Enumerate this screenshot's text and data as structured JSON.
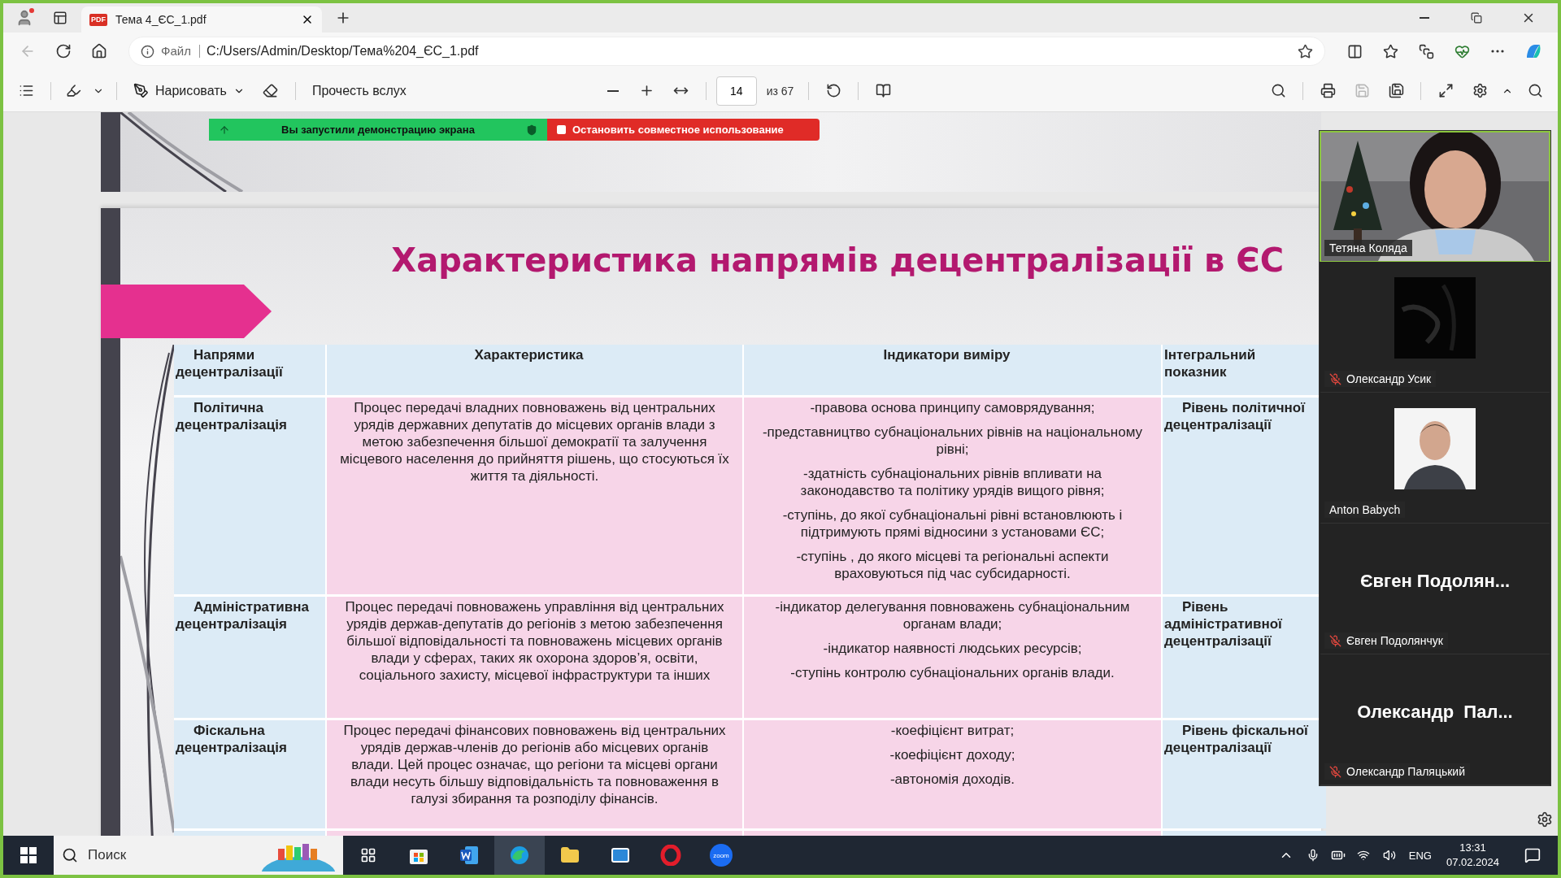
{
  "browser": {
    "tab": {
      "title": "Тема 4_ЄС_1.pdf",
      "file_badge": "PDF",
      "selected": true
    },
    "back": {
      "disabled": true
    },
    "address": {
      "scheme": "Файл",
      "url": "C:/Users/Admin/Desktop/Тема%204_ЄС_1.pdf"
    }
  },
  "pdf_toolbar": {
    "draw_label": "Нарисовать",
    "read_aloud_label": "Прочесть вслух",
    "page": "14",
    "page_total": "из 67",
    "save": {
      "disabled": true
    }
  },
  "share_banner": {
    "status": "Вы запустили демонстрацию экрана",
    "stop_label": "Остановить совместное использование"
  },
  "slide": {
    "title": "Характеристика напрямів децентралізації в ЄС",
    "table": {
      "columns": [
        "Напрями децентралізації",
        "Характеристика",
        "Індикатори виміру",
        "Інтегральний показник"
      ],
      "rows": [
        {
          "direction": "Політична децентралізація",
          "description": "Процес передачі владних повноважень від центральних урядів державних депутатів до місцевих органів влади з метою забезпечення більшої демократії та залучення місцевого населення до прийняття рішень, що стосуються їх життя та діяльності.",
          "indicators": [
            "-правова основа принципу самоврядування;",
            "-представництво субнаціональних рівнів на національному рівні;",
            "-здатність субнаціональних рівнів впливати на законодавство та політику урядів вищого рівня;",
            "-ступінь, до якої субнаціональні рівні встановлюють і підтримують прямі відносини з установами ЄС;",
            "-ступінь , до якого місцеві та регіональні аспекти враховуються під час субсидарності."
          ],
          "integral": "Рівень політичної децентралізації"
        },
        {
          "direction": "Адміністративна децентралізація",
          "description": "Процес передачі повноважень управління від центральних урядів держав-депутатів до регіонів з метою забезпечення більшої відповідальності та повноважень місцевих органів влади у сферах, таких як охорона здоров’я, освіти, соціального захисту, місцевої інфраструктури та інших",
          "indicators": [
            "-індикатор делегування повноважень субнаціональним органам влади;",
            "-індикатор наявності людських ресурсів;",
            "-ступінь контролю субнаціональних органів влади."
          ],
          "integral": "Рівень адміністративної децентралізації"
        },
        {
          "direction": "Фіскальна децентралізація",
          "description": "Процес передачі фінансових повноважень від центральних урядів держав-членів до регіонів або місцевих органів влади. Цей процес означає, що регіони та місцеві органи влади несуть більшу відповідальність та повноваження в галузі збирання та розподілу фінансів.",
          "indicators": [
            "-коефіцієнт витрат;",
            "-коефіцієнт доходу;",
            "-автономія доходів."
          ],
          "integral": "Рівень фіскальної децентралізації"
        }
      ]
    }
  },
  "participants": [
    {
      "kind": "video",
      "name": "Тетяна Коляда",
      "muted": false,
      "speaking": true
    },
    {
      "kind": "dark_video",
      "name": "Олександр Усик",
      "muted": true,
      "speaking": false
    },
    {
      "name": "Anton Babych",
      "muted": false,
      "speaking": false
    },
    {
      "kind": "name",
      "display_name": "Євген Подолян...",
      "name": "Євген Подолянчук",
      "muted": true,
      "speaking": false
    },
    {
      "kind": "name",
      "display_name": "Олександр  Пал...",
      "name": "Олександр Паляцький",
      "muted": true,
      "speaking": false
    }
  ],
  "taskbar": {
    "search_placeholder": "Поиск",
    "app_badge": "zoom",
    "language": "ENG",
    "time": "13:31",
    "date": "07.02.2024"
  }
}
